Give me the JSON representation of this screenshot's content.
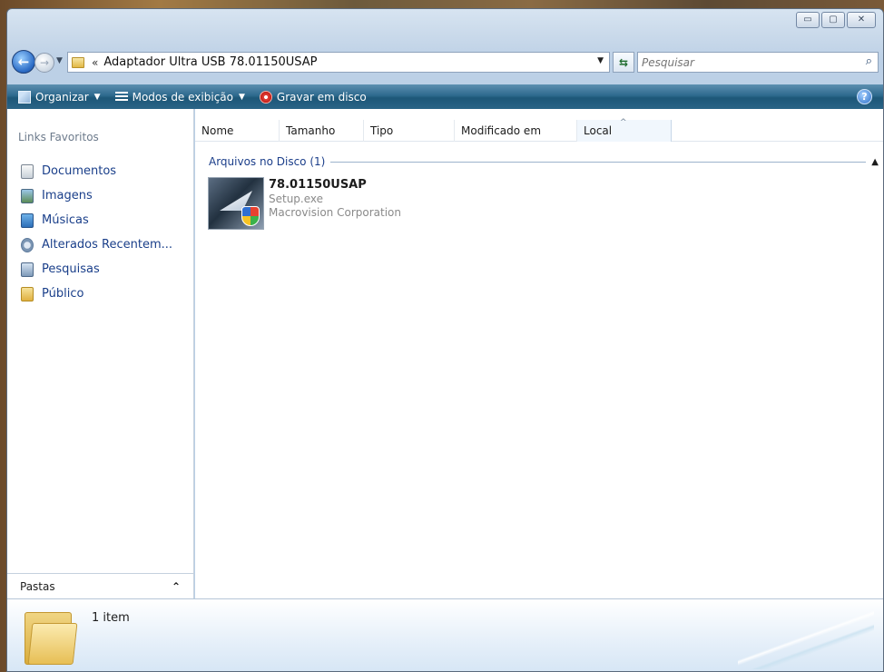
{
  "window": {
    "caption_buttons": {
      "minimize": "▭",
      "maximize": "▢",
      "close": "✕"
    }
  },
  "address": {
    "chevron": "«",
    "path": "Adaptador Ultra USB 78.01150USAP",
    "search_placeholder": "Pesquisar"
  },
  "toolbar": {
    "organize_label": "Organizar",
    "views_label": "Modos de exibição",
    "burn_label": "Gravar em disco",
    "help_glyph": "?"
  },
  "nav_pane": {
    "title": "Links Favoritos",
    "items": [
      {
        "label": "Documentos",
        "icon": "documents-icon"
      },
      {
        "label": "Imagens",
        "icon": "pictures-icon"
      },
      {
        "label": "Músicas",
        "icon": "music-icon"
      },
      {
        "label": "Alterados Recentem...",
        "icon": "recent-icon"
      },
      {
        "label": "Pesquisas",
        "icon": "searches-icon"
      },
      {
        "label": "Público",
        "icon": "public-folder-icon"
      }
    ],
    "folders_label": "Pastas"
  },
  "columns": [
    "Nome",
    "Tamanho",
    "Tipo",
    "Modificado em",
    "Local"
  ],
  "group": {
    "label": "Arquivos no Disco (1)"
  },
  "file": {
    "name": "78.01150USAP",
    "filename": "Setup.exe",
    "company": "Macrovision Corporation"
  },
  "details": {
    "item_count": "1 item"
  },
  "colors": {
    "toolbar": "#2e6a8e",
    "link": "#1a3f8a",
    "group": "#1b3e8a"
  }
}
